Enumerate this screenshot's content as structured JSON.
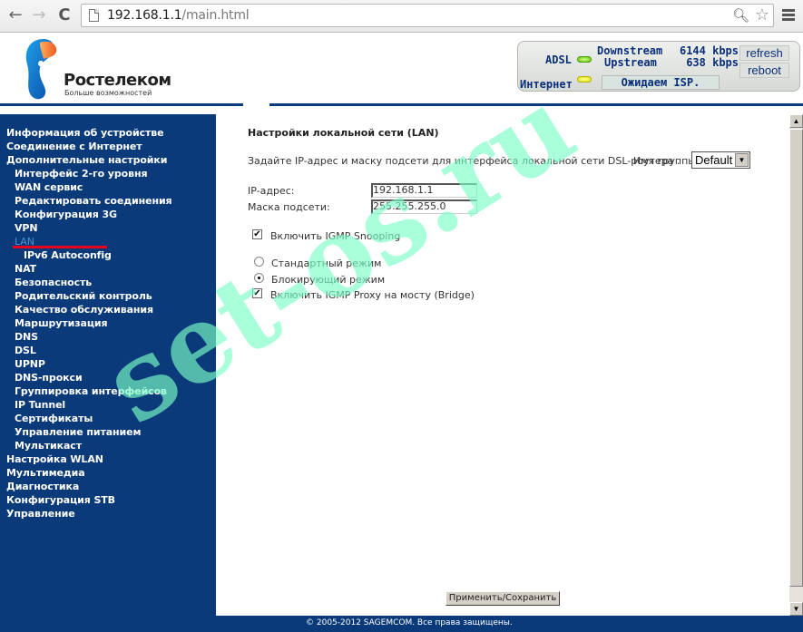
{
  "browser": {
    "url_host": "192.168.1.1",
    "url_path": "/main.html",
    "icons": [
      "back-arrow-icon",
      "forward-arrow-icon",
      "reload-icon",
      "page-icon",
      "zoom-icon",
      "star-icon",
      "menu-icon"
    ],
    "glyphs": {
      "back": "←",
      "forward": "→",
      "reload": "C",
      "zoom": "🔍︎",
      "star": "☆"
    }
  },
  "header": {
    "brand": "Ростелеком",
    "tagline": "Больше возможностей",
    "status": {
      "adsl_label": "ADSL",
      "downstream_label": "Downstream",
      "downstream_value": "6144 kbps",
      "upstream_label": "Upstream",
      "upstream_value": "638 kbps",
      "internet_label": "Интернет",
      "isp_status": "Ожидаем ISP.",
      "refresh_label": "refresh",
      "reboot_label": "reboot",
      "adsl_led_color": "#5ec100",
      "internet_led_color": "#e3e000"
    }
  },
  "sidebar": {
    "items": [
      {
        "label": "Информация об устройстве",
        "level": 1
      },
      {
        "label": "Соединение с Интернет",
        "level": 1
      },
      {
        "label": "Дополнительные настройки",
        "level": 1
      },
      {
        "label": "Интерфейс 2-го уровня",
        "level": 2
      },
      {
        "label": "WAN сервис",
        "level": 2
      },
      {
        "label": "Редактировать соединения",
        "level": 2
      },
      {
        "label": "Конфигурация 3G",
        "level": 2
      },
      {
        "label": "VPN",
        "level": 2
      },
      {
        "label": "LAN",
        "level": 2,
        "active": true
      },
      {
        "label": "IPv6 Autoconfig",
        "level": 3
      },
      {
        "label": "NAT",
        "level": 2
      },
      {
        "label": "Безопасность",
        "level": 2
      },
      {
        "label": "Родительский контроль",
        "level": 2
      },
      {
        "label": "Качество обслуживания",
        "level": 2
      },
      {
        "label": "Маршрутизация",
        "level": 2
      },
      {
        "label": "DNS",
        "level": 2
      },
      {
        "label": "DSL",
        "level": 2
      },
      {
        "label": "UPNP",
        "level": 2
      },
      {
        "label": "DNS-прокси",
        "level": 2
      },
      {
        "label": "Группировка интерфейсов",
        "level": 2
      },
      {
        "label": "IP Tunnel",
        "level": 2
      },
      {
        "label": "Сертификаты",
        "level": 2
      },
      {
        "label": "Управление питанием",
        "level": 2
      },
      {
        "label": "Мультикаст",
        "level": 2
      },
      {
        "label": "Настройка WLAN",
        "level": 1
      },
      {
        "label": "Мультимедиа",
        "level": 1
      },
      {
        "label": "Диагностика",
        "level": 1
      },
      {
        "label": "Конфигурация STB",
        "level": 1
      },
      {
        "label": "Управление",
        "level": 1
      }
    ],
    "accent_color": "#e8001c"
  },
  "main": {
    "title": "Настройки локальной сети (LAN)",
    "description": "Задайте IP-адрес и маску подсети для интерфейса локальной сети DSL-роутера .",
    "group_label": "Имя группы",
    "group_value": "Default",
    "ip_label": "IP-адрес:",
    "ip_value": "192.168.1.1",
    "mask_label": "Маска подсети:",
    "mask_value": "255.255.255.0",
    "igmp_snooping_label": "Включить IGMP Snooping",
    "igmp_snooping_checked": true,
    "mode_standard_label": "Стандартный режим",
    "mode_blocking_label": "Блокирующий режим",
    "mode_selected": "blocking",
    "igmp_proxy_label": "Включить IGMP Proxy на мосту (Bridge)",
    "igmp_proxy_checked": true,
    "apply_label": "Применить/Сохранить",
    "check_glyph": "✔"
  },
  "footer": {
    "copyright": "© 2005-2012 SAGEMCOM. Все права защищены."
  },
  "watermark": {
    "text": "set-os.ru",
    "color": "#7dffc8"
  }
}
